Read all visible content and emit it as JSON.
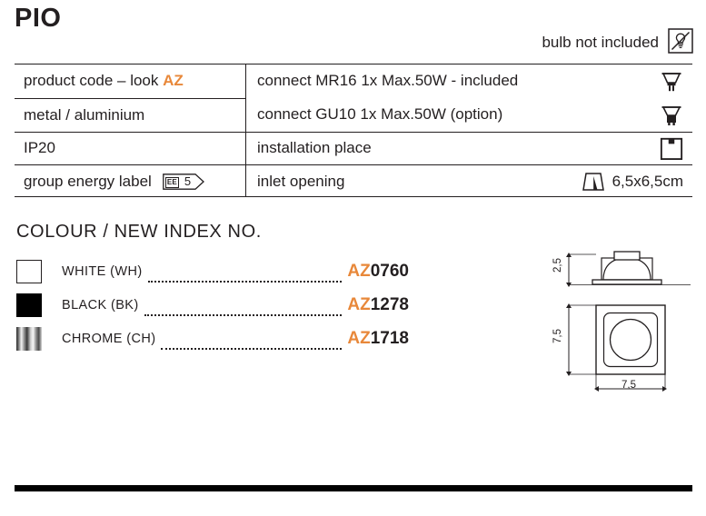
{
  "header": {
    "title": "PIO",
    "bulb_note": "bulb not included",
    "bulb_icon_name": "bulb-not-included-icon"
  },
  "spec_table": {
    "left_rows": [
      {
        "text_before": "product code – look ",
        "accent": "AZ",
        "text_after": ""
      },
      {
        "text_before": "metal / aluminium",
        "accent": "",
        "text_after": ""
      },
      {
        "text_before": "IP20",
        "accent": "",
        "text_after": ""
      },
      {
        "text_before": "group energy label",
        "accent": "",
        "text_after": ""
      }
    ],
    "energy_label": {
      "prefix": "EE",
      "value": "5"
    },
    "right_rows": [
      {
        "text": "connect MR16 1x Max.50W - included",
        "icon": "mr16-bulb-icon"
      },
      {
        "text": "connect GU10 1x Max.50W (option)",
        "icon": "gu10-bulb-icon"
      },
      {
        "text": "installation place",
        "icon": "ceiling-recessed-icon"
      },
      {
        "text": "inlet opening",
        "icon": "inlet-opening-icon",
        "value": "6,5x6,5cm"
      }
    ]
  },
  "colour_section": {
    "heading": "COLOUR / NEW INDEX NO.",
    "rows": [
      {
        "name": "WHITE (WH)",
        "swatch": "white",
        "code_prefix": "AZ",
        "code_number": "0760"
      },
      {
        "name": "BLACK (BK)",
        "swatch": "black",
        "code_prefix": "AZ",
        "code_number": "1278"
      },
      {
        "name": "CHROME (CH)",
        "swatch": "chrome",
        "code_prefix": "AZ",
        "code_number": "1718"
      }
    ]
  },
  "drawings": {
    "side_height": "2,5",
    "front_height": "7,5",
    "front_width": "7,5"
  },
  "colors": {
    "accent": "#e8883a",
    "ink": "#231f20",
    "bar": "#000000"
  }
}
